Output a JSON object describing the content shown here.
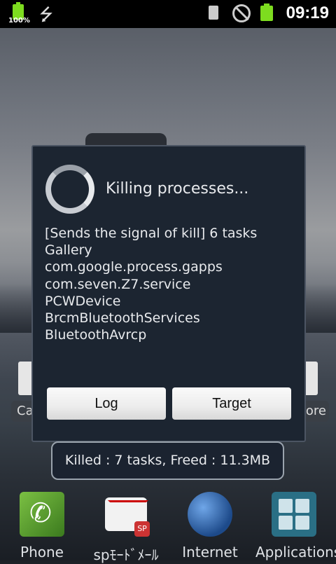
{
  "status_bar": {
    "battery_left_label": "100%",
    "clock": "09:19",
    "icons": [
      "battery-icon",
      "usb-icon",
      "sim-icon",
      "no-signal-icon",
      "battery-icon"
    ]
  },
  "home_screen": {
    "left_button_fragment": "Ca",
    "right_button_fragment": "ore"
  },
  "dialog": {
    "title": "Killing processes...",
    "message_lines": [
      "[Sends the signal of kill] 6 tasks",
      "Gallery",
      "com.google.process.gapps",
      "com.seven.Z7.service",
      "PCWDevice",
      "BrcmBluetoothServices",
      "BluetoothAvrcp"
    ],
    "buttons": {
      "log": "Log",
      "target": "Target"
    }
  },
  "toast": {
    "text": "Killed : 7 tasks, Freed : 11.3MB"
  },
  "dock": {
    "items": [
      {
        "label": "Phone",
        "icon": "phone-icon"
      },
      {
        "label": "spﾓｰﾄﾞﾒｰﾙ",
        "icon": "mail-icon"
      },
      {
        "label": "Internet",
        "icon": "globe-icon"
      },
      {
        "label": "Applications",
        "icon": "apps-grid-icon"
      }
    ],
    "mail_badge": "SP"
  },
  "colors": {
    "dialog_bg": "#1c2531",
    "battery_green": "#7ddc1f",
    "text": "#e8eaed"
  }
}
